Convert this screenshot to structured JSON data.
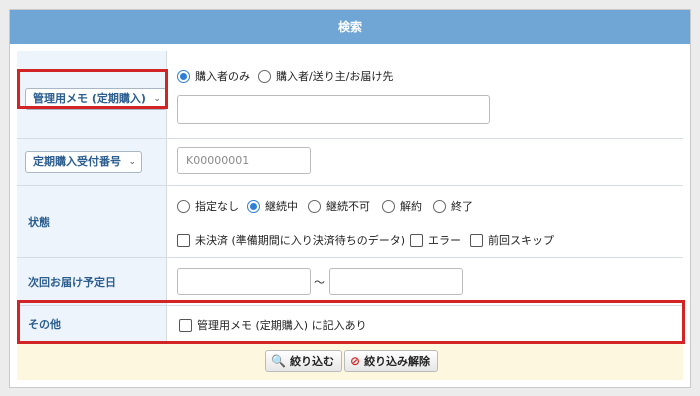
{
  "header": {
    "title": "検索"
  },
  "memo_row": {
    "select_label": "管理用メモ (定期購入)",
    "radio_options": [
      "購入者のみ",
      "購入者/送り主/お届け先"
    ],
    "selected_index": 0,
    "input_value": ""
  },
  "number_row": {
    "select_label": "定期購入受付番号",
    "input_placeholder": "K00000001"
  },
  "status_row": {
    "label": "状態",
    "radio_options": [
      "指定なし",
      "継続中",
      "継続不可",
      "解約",
      "終了"
    ],
    "selected_index": 1,
    "checkboxes": [
      "未決済 (準備期間に入り決済待ちのデータ)",
      "エラー",
      "前回スキップ"
    ]
  },
  "date_row": {
    "label": "次回お届け予定日",
    "separator": "〜",
    "from_value": "",
    "to_value": ""
  },
  "other_row": {
    "label": "その他",
    "checkbox_label": "管理用メモ (定期購入) に記入あり"
  },
  "footer": {
    "search_button": "絞り込む",
    "clear_button": "絞り込み解除"
  },
  "colors": {
    "header_bg": "#6fa6d6",
    "label_bg": "#eef4fb",
    "label_text": "#2b5d8f",
    "highlight": "#d22424",
    "footer_bg": "#fcf7de"
  }
}
